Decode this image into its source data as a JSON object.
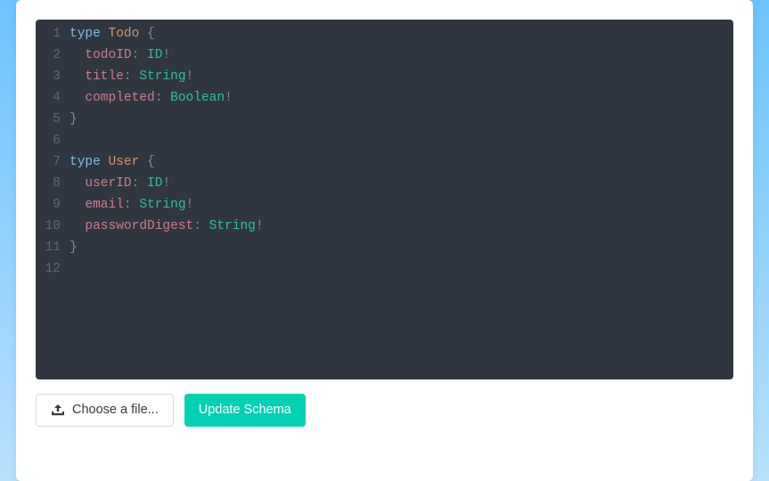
{
  "editor": {
    "lines": [
      {
        "n": 1,
        "tokens": [
          [
            "keyword",
            "type"
          ],
          [
            "plain",
            " "
          ],
          [
            "typename",
            "Todo"
          ],
          [
            "plain",
            " "
          ],
          [
            "punc",
            "{"
          ]
        ]
      },
      {
        "n": 2,
        "tokens": [
          [
            "plain",
            "  "
          ],
          [
            "field",
            "todoID"
          ],
          [
            "punc",
            ":"
          ],
          [
            "plain",
            " "
          ],
          [
            "type",
            "ID"
          ],
          [
            "bang",
            "!"
          ]
        ]
      },
      {
        "n": 3,
        "tokens": [
          [
            "plain",
            "  "
          ],
          [
            "field",
            "title"
          ],
          [
            "punc",
            ":"
          ],
          [
            "plain",
            " "
          ],
          [
            "type",
            "String"
          ],
          [
            "bang",
            "!"
          ]
        ]
      },
      {
        "n": 4,
        "tokens": [
          [
            "plain",
            "  "
          ],
          [
            "field",
            "completed"
          ],
          [
            "punc",
            ":"
          ],
          [
            "plain",
            " "
          ],
          [
            "type",
            "Boolean"
          ],
          [
            "bang",
            "!"
          ]
        ]
      },
      {
        "n": 5,
        "tokens": [
          [
            "punc",
            "}"
          ]
        ]
      },
      {
        "n": 6,
        "tokens": []
      },
      {
        "n": 7,
        "tokens": [
          [
            "keyword",
            "type"
          ],
          [
            "plain",
            " "
          ],
          [
            "typename",
            "User"
          ],
          [
            "plain",
            " "
          ],
          [
            "punc",
            "{"
          ]
        ]
      },
      {
        "n": 8,
        "tokens": [
          [
            "plain",
            "  "
          ],
          [
            "field",
            "userID"
          ],
          [
            "punc",
            ":"
          ],
          [
            "plain",
            " "
          ],
          [
            "type",
            "ID"
          ],
          [
            "bang",
            "!"
          ]
        ]
      },
      {
        "n": 9,
        "tokens": [
          [
            "plain",
            "  "
          ],
          [
            "field",
            "email"
          ],
          [
            "punc",
            ":"
          ],
          [
            "plain",
            " "
          ],
          [
            "type",
            "String"
          ],
          [
            "bang",
            "!"
          ]
        ]
      },
      {
        "n": 10,
        "tokens": [
          [
            "plain",
            "  "
          ],
          [
            "field",
            "passwordDigest"
          ],
          [
            "punc",
            ":"
          ],
          [
            "plain",
            " "
          ],
          [
            "type",
            "String"
          ],
          [
            "bang",
            "!"
          ]
        ]
      },
      {
        "n": 11,
        "tokens": [
          [
            "punc",
            "}"
          ]
        ]
      },
      {
        "n": 12,
        "tokens": []
      }
    ]
  },
  "toolbar": {
    "choose_file_label": "Choose a file...",
    "update_schema_label": "Update Schema"
  }
}
